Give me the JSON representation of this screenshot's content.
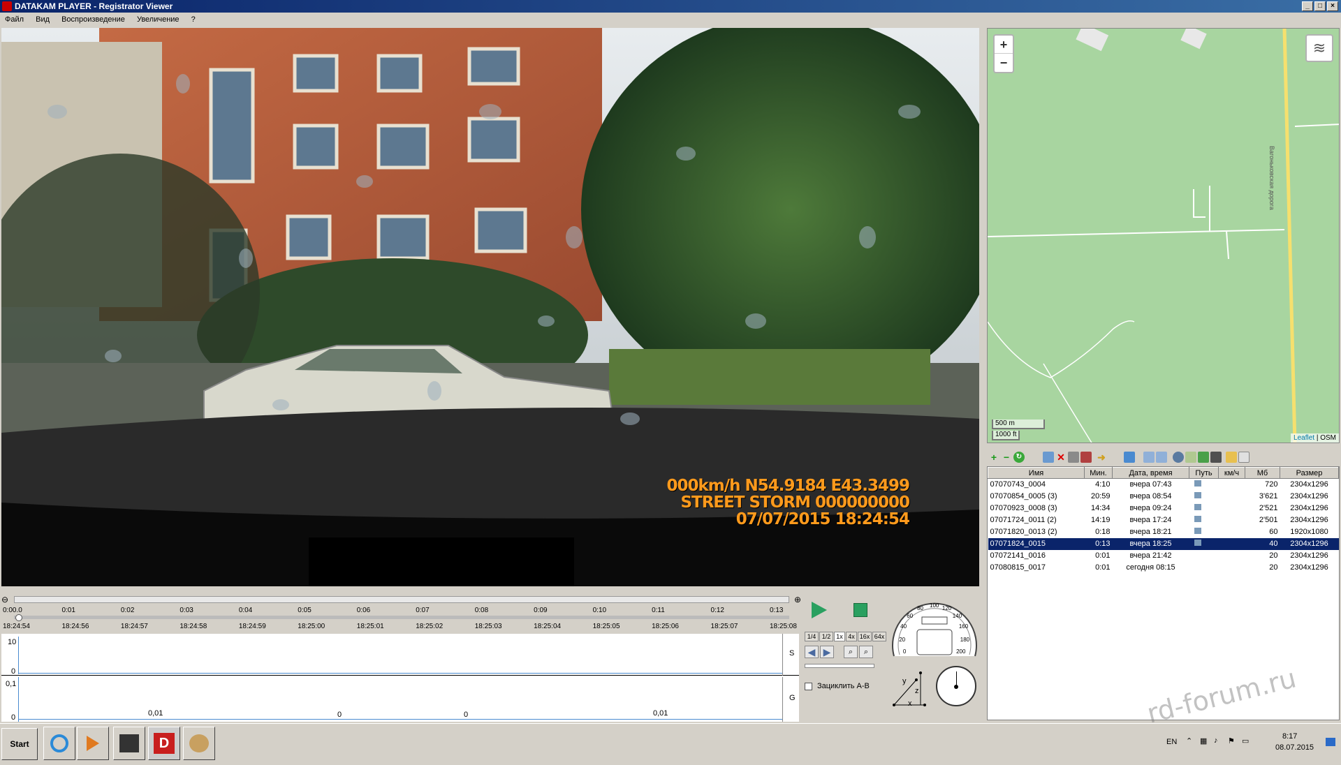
{
  "window": {
    "title": "DATAKAM PLAYER - Registrator Viewer",
    "buttons": {
      "minimize": "_",
      "maximize": "□",
      "close": "×"
    }
  },
  "menu": [
    "Файл",
    "Вид",
    "Воспроизведение",
    "Увеличение",
    "?"
  ],
  "video": {
    "osd_line1": "000km/h N54.9184 E43.3499",
    "osd_line2": "STREET STORM 000000000",
    "osd_line3": "07/07/2015 18:24:54"
  },
  "map": {
    "zoom_in": "+",
    "zoom_out": "−",
    "layers_icon": "layers-icon",
    "scale_metric": "500 m",
    "scale_imperial": "1000 ft",
    "road_label": "Вагоньковская дорога",
    "attribution_link": "Leaflet",
    "attribution_sep": " | ",
    "attribution_osm": "OSM"
  },
  "filelist": {
    "columns": [
      "Имя",
      "Мин.",
      "Дата, время",
      "Путь",
      "км/ч",
      "Мб",
      "Размер"
    ],
    "rows": [
      {
        "name": "07070743_0004",
        "min": "4:10",
        "datetime": "вчера 07:43",
        "mb": "720",
        "size": "2304x1296",
        "path": true,
        "selected": false
      },
      {
        "name": "07070854_0005 (3)",
        "min": "20:59",
        "datetime": "вчера 08:54",
        "mb": "3'621",
        "size": "2304x1296",
        "path": true,
        "selected": false
      },
      {
        "name": "07070923_0008 (3)",
        "min": "14:34",
        "datetime": "вчера 09:24",
        "mb": "2'521",
        "size": "2304x1296",
        "path": true,
        "selected": false
      },
      {
        "name": "07071724_0011 (2)",
        "min": "14:19",
        "datetime": "вчера 17:24",
        "mb": "2'501",
        "size": "2304x1296",
        "path": true,
        "selected": false
      },
      {
        "name": "07071820_0013 (2)",
        "min": "0:18",
        "datetime": "вчера 18:21",
        "mb": "60",
        "size": "1920x1080",
        "path": true,
        "selected": false
      },
      {
        "name": "07071824_0015",
        "min": "0:13",
        "datetime": "вчера 18:25",
        "mb": "40",
        "size": "2304x1296",
        "path": true,
        "selected": true
      },
      {
        "name": "07072141_0016",
        "min": "0:01",
        "datetime": "вчера 21:42",
        "mb": "20",
        "size": "2304x1296",
        "path": false,
        "selected": false
      },
      {
        "name": "07080815_0017",
        "min": "0:01",
        "datetime": "сегодня 08:15",
        "mb": "20",
        "size": "2304x1296",
        "path": false,
        "selected": false
      }
    ]
  },
  "timeline": {
    "elapsed": [
      "0:00.0",
      "0:01",
      "0:02",
      "0:03",
      "0:04",
      "0:05",
      "0:06",
      "0:07",
      "0:08",
      "0:09",
      "0:10",
      "0:11",
      "0:12",
      "0:13"
    ],
    "clock": [
      "18:24:54",
      "18:24:56",
      "18:24:57",
      "18:24:58",
      "18:24:59",
      "18:25:00",
      "18:25:01",
      "18:25:02",
      "18:25:03",
      "18:25:04",
      "18:25:05",
      "18:25:06",
      "18:25:07",
      "18:25:08"
    ]
  },
  "graphs": {
    "speed": {
      "axis_max": "10",
      "axis_min": "0",
      "side_label": "S"
    },
    "g": {
      "axis_max": "0,1",
      "axis_min": "0",
      "side_label": "G",
      "labels": [
        "0,01",
        "0",
        "0",
        "0,01"
      ]
    }
  },
  "controls": {
    "speeds": [
      "1/4",
      "1/2",
      "1x",
      "4x",
      "16x",
      "64x"
    ],
    "active_speed": "1x",
    "loop_label": "Зациклить A-B",
    "speedo_ticks": [
      "0",
      "20",
      "40",
      "60",
      "80",
      "100",
      "120",
      "140",
      "160",
      "180",
      "200"
    ],
    "axis_labels": {
      "x": "x",
      "y": "y",
      "z": "z"
    }
  },
  "taskbar": {
    "start": "Start",
    "lang": "EN",
    "time": "8:17",
    "date": "08.07.2015"
  },
  "watermark": "rd-forum.ru"
}
